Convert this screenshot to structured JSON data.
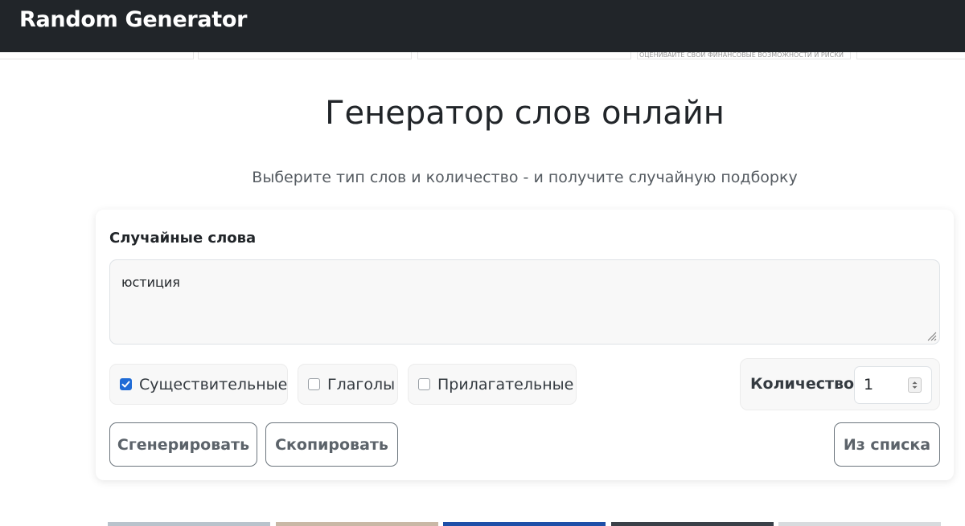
{
  "navbar": {
    "brand": "Random Generator"
  },
  "ad": {
    "text": "ОЦЕНИВАЙТЕ СВОИ ФИНАНСОВЫЕ ВОЗМОЖНОСТИ И РИСКИ"
  },
  "page": {
    "title": "Генератор слов онлайн",
    "subtitle": "Выберите тип слов и количество - и получите случайную подборку"
  },
  "card": {
    "title": "Случайные слова",
    "output_value": "юстиция",
    "options": [
      {
        "label": "Существительные",
        "checked": true
      },
      {
        "label": "Глаголы",
        "checked": false
      },
      {
        "label": "Прилагательные",
        "checked": false
      }
    ],
    "quantity": {
      "label": "Количество",
      "value": "1"
    },
    "buttons": {
      "generate": "Сгенерировать",
      "copy": "Скопировать",
      "from_list": "Из списка"
    }
  },
  "colors": {
    "navbar": "#212529",
    "checkbox_checked": "#1f6bd6",
    "button_border": "#6c757d"
  }
}
